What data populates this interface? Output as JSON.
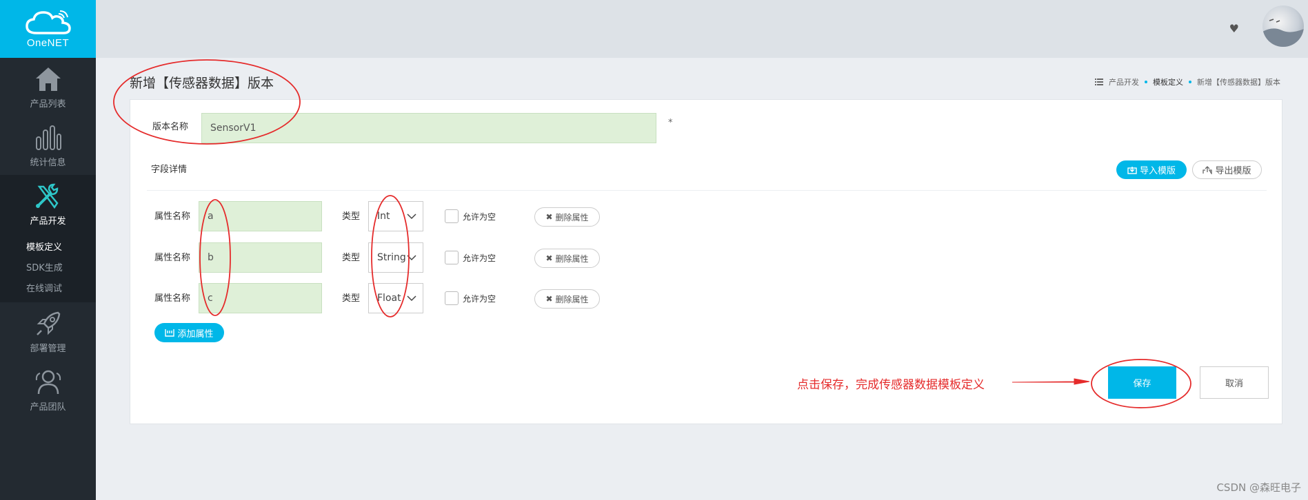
{
  "app": {
    "logo_text": "OneNET"
  },
  "sidebar": {
    "items": [
      {
        "label": "产品列表",
        "icon": "home-icon"
      },
      {
        "label": "统计信息",
        "icon": "bar-chart-icon"
      },
      {
        "label": "产品开发",
        "icon": "tools-icon",
        "active": true
      },
      {
        "label": "部署管理",
        "icon": "rocket-icon"
      },
      {
        "label": "产品团队",
        "icon": "users-icon"
      }
    ],
    "subitems": [
      {
        "label": "模板定义",
        "active": true
      },
      {
        "label": "SDK生成"
      },
      {
        "label": "在线调试"
      }
    ]
  },
  "topbar": {
    "heart_icon": "heart-icon"
  },
  "page": {
    "title": "新增【传感器数据】版本"
  },
  "breadcrumb": {
    "items": [
      "产品开发",
      "模板定义",
      "新增【传感器数据】版本"
    ]
  },
  "form": {
    "version_label": "版本名称",
    "version_value": "SensorV1",
    "required_mark": "*",
    "fields_label": "字段详情",
    "import_label": "导入模版",
    "export_label": "导出模版",
    "properties": [
      {
        "name_label": "属性名称",
        "name": "a",
        "type_label": "类型",
        "type": "Int",
        "nullable_label": "允许为空",
        "delete_label": "删除属性"
      },
      {
        "name_label": "属性名称",
        "name": "b",
        "type_label": "类型",
        "type": "String",
        "nullable_label": "允许为空",
        "delete_label": "删除属性"
      },
      {
        "name_label": "属性名称",
        "name": "c",
        "type_label": "类型",
        "type": "Float",
        "nullable_label": "允许为空",
        "delete_label": "删除属性"
      }
    ],
    "add_label": "添加属性",
    "save_label": "保存",
    "cancel_label": "取消"
  },
  "annotation": {
    "text": "点击保存，完成传感器数据模板定义",
    "color": "#e52b2b"
  },
  "watermark": "CSDN @森旺电子",
  "colors": {
    "accent": "#00b7e8",
    "sidebar": "#232a31",
    "input_bg": "#dff0d8"
  }
}
